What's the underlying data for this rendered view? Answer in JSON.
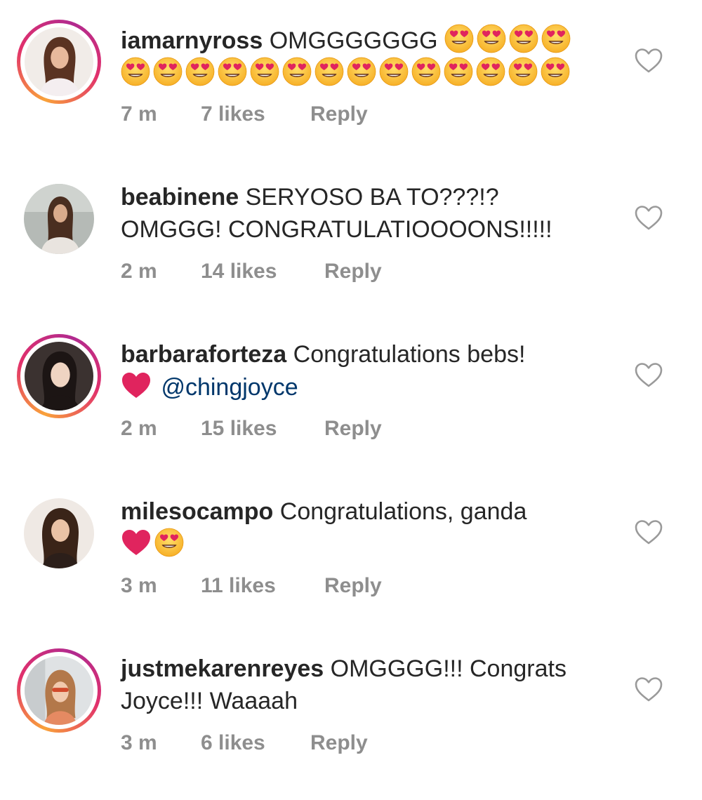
{
  "comments": [
    {
      "username": "iamarnyross",
      "text_line1": "OMGGGGGGG",
      "text_line2": "",
      "mention": "",
      "time": "7 m",
      "likes": "7 likes",
      "reply": "Reply",
      "avatar_ring": "story",
      "emoji_line1": [
        "heart-eyes-icon",
        "heart-eyes-icon",
        "heart-eyes-icon",
        "heart-eyes-icon"
      ],
      "emoji_line2": [
        "heart-eyes-icon",
        "heart-eyes-icon",
        "heart-eyes-icon",
        "heart-eyes-icon",
        "heart-eyes-icon",
        "heart-eyes-icon",
        "heart-eyes-icon",
        "heart-eyes-icon",
        "heart-eyes-icon",
        "heart-eyes-icon",
        "heart-eyes-icon",
        "heart-eyes-icon",
        "heart-eyes-icon",
        "heart-eyes-icon"
      ]
    },
    {
      "username": "beabinene",
      "text_line1": "SERYOSO BA TO???!?",
      "text_line2": "OMGGG! CONGRATULATIOOOONS!!!!!",
      "mention": "",
      "time": "2 m",
      "likes": "14 likes",
      "reply": "Reply",
      "avatar_ring": "plain",
      "emoji_line1": [],
      "emoji_line2": []
    },
    {
      "username": "barbaraforteza",
      "text_line1": "Congratulations bebs!",
      "text_line2": "",
      "mention": "@chingjoyce",
      "time": "2 m",
      "likes": "15 likes",
      "reply": "Reply",
      "avatar_ring": "story",
      "emoji_line1": [],
      "emoji_line2": [
        "red-heart-icon"
      ]
    },
    {
      "username": "milesocampo",
      "text_line1": "Congratulations, ganda",
      "text_line2": "",
      "mention": "",
      "time": "3 m",
      "likes": "11 likes",
      "reply": "Reply",
      "avatar_ring": "plain",
      "emoji_line1": [],
      "emoji_line2": [
        "red-heart-icon",
        "heart-eyes-icon"
      ]
    },
    {
      "username": "justmekarenreyes",
      "text_line1": "OMGGGG!!! Congrats",
      "text_line2": "Joyce!!! Waaaah",
      "mention": "",
      "time": "3 m",
      "likes": "6 likes",
      "reply": "Reply",
      "avatar_ring": "story",
      "emoji_line1": [],
      "emoji_line2": []
    }
  ],
  "colors": {
    "meta_gray": "#8e8e8e",
    "text": "#262626",
    "mention": "#00376b",
    "heart_red": "#e0245e",
    "emoji_yellow": "#ffc83d"
  }
}
